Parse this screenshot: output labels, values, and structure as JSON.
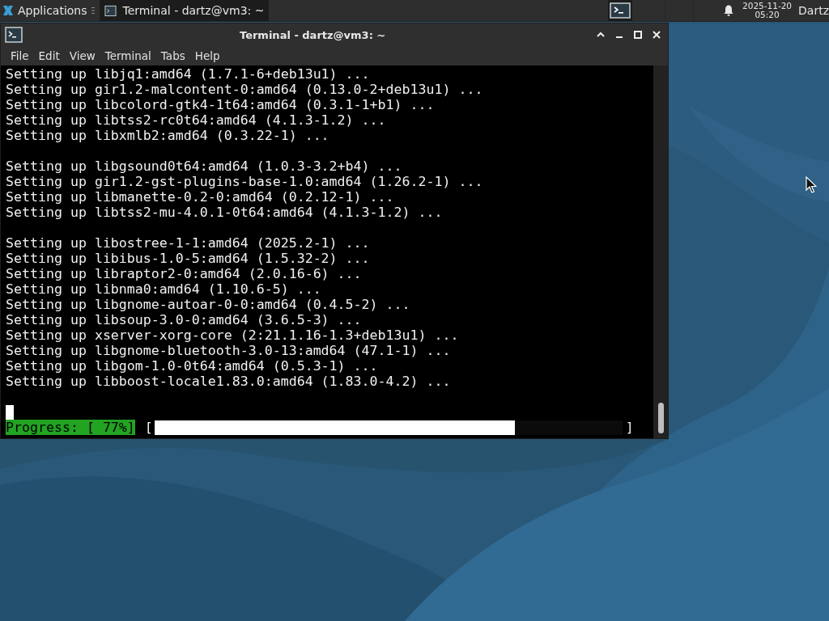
{
  "panel": {
    "apps_menu": "Applications",
    "tasks": [
      {
        "title": "Terminal - dartz@vm3: ~",
        "selected": true
      }
    ],
    "clock": {
      "date": "2025-11-20",
      "time": "05:20"
    },
    "user": "Dartz"
  },
  "window": {
    "title": "Terminal - dartz@vm3: ~",
    "menu": [
      "File",
      "Edit",
      "View",
      "Terminal",
      "Tabs",
      "Help"
    ]
  },
  "terminal": {
    "blocks": [
      [
        "Setting up libjq1:amd64 (1.7.1-6+deb13u1) ...",
        "Setting up gir1.2-malcontent-0:amd64 (0.13.0-2+deb13u1) ...",
        "Setting up libcolord-gtk4-1t64:amd64 (0.3.1-1+b1) ...",
        "Setting up libtss2-rc0t64:amd64 (4.1.3-1.2) ...",
        "Setting up libxmlb2:amd64 (0.3.22-1) ..."
      ],
      [
        "Setting up libgsound0t64:amd64 (1.0.3-3.2+b4) ...",
        "Setting up gir1.2-gst-plugins-base-1.0:amd64 (1.26.2-1) ...",
        "Setting up libmanette-0.2-0:amd64 (0.2.12-1) ...",
        "Setting up libtss2-mu-4.0.1-0t64:amd64 (4.1.3-1.2) ..."
      ],
      [
        "Setting up libostree-1-1:amd64 (2025.2-1) ...",
        "Setting up libibus-1.0-5:amd64 (1.5.32-2) ...",
        "Setting up libraptor2-0:amd64 (2.0.16-6) ...",
        "Setting up libnma0:amd64 (1.10.6-5) ...",
        "Setting up libgnome-autoar-0-0:amd64 (0.4.5-2) ...",
        "Setting up libsoup-3.0-0:amd64 (3.6.5-3) ...",
        "Setting up xserver-xorg-core (2:21.1.16-1.3+deb13u1) ...",
        "Setting up libgnome-bluetooth-3.0-13:amd64 (47.1-1) ...",
        "Setting up libgom-1.0-0t64:amd64 (0.5.3-1) ...",
        "Setting up libboost-locale1.83.0:amd64 (1.83.0-4.2) ..."
      ]
    ],
    "progress": {
      "label": "Progress: [ 77%]",
      "open": "[",
      "close": "]",
      "level": 0.77
    }
  }
}
